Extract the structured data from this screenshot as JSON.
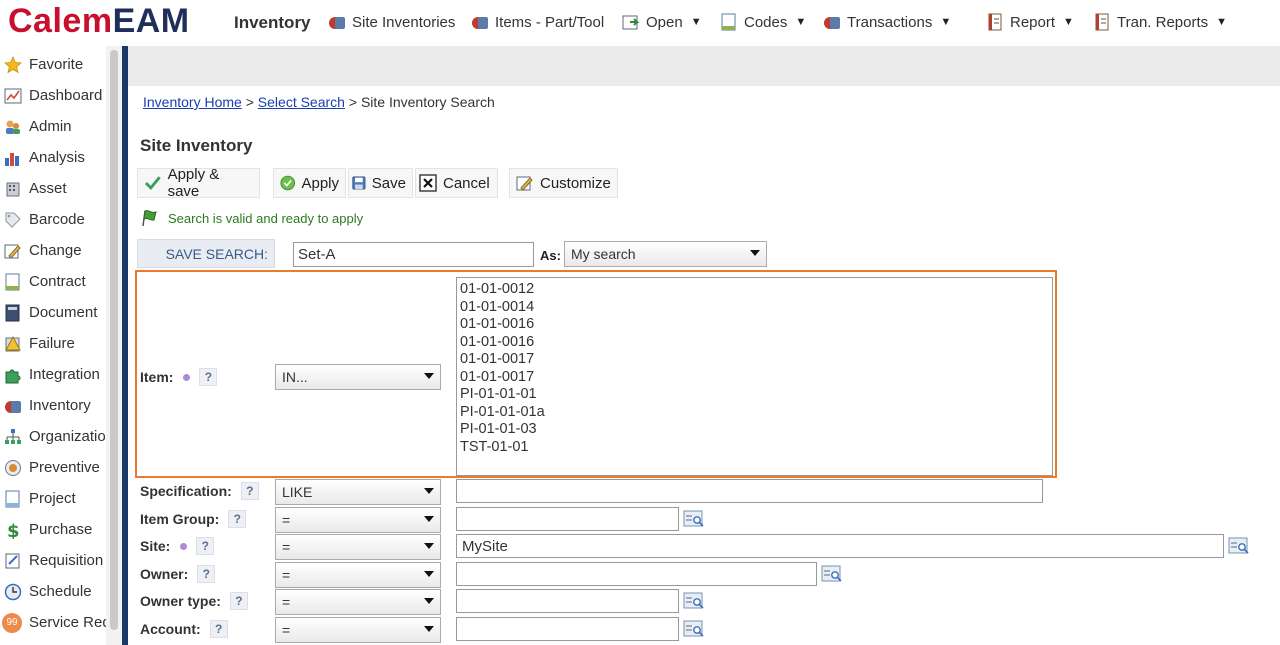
{
  "header": {
    "logo_part1": "Calem",
    "logo_part2": "EAM",
    "module": "Inventory",
    "menus": [
      {
        "label": "Site Inventories",
        "icon": "inventory-icon",
        "caret": false
      },
      {
        "label": "Items - Part/Tool",
        "icon": "inventory-icon",
        "caret": false
      },
      {
        "label": "Open",
        "icon": "open-icon",
        "caret": true
      },
      {
        "label": "Codes",
        "icon": "document-icon",
        "caret": true
      },
      {
        "label": "Transactions",
        "icon": "inventory-icon",
        "caret": true
      },
      {
        "label": "Report",
        "icon": "report-icon",
        "caret": true
      },
      {
        "label": "Tran. Reports",
        "icon": "report-icon",
        "caret": true
      }
    ]
  },
  "sidebar": {
    "items": [
      {
        "label": "Favorite",
        "icon": "star-icon"
      },
      {
        "label": "Dashboard",
        "icon": "dashboard-icon"
      },
      {
        "label": "Admin",
        "icon": "admin-icon"
      },
      {
        "label": "Analysis",
        "icon": "analysis-icon"
      },
      {
        "label": "Asset",
        "icon": "asset-icon"
      },
      {
        "label": "Barcode",
        "icon": "barcode-icon"
      },
      {
        "label": "Change",
        "icon": "change-icon"
      },
      {
        "label": "Contract",
        "icon": "contract-icon"
      },
      {
        "label": "Document",
        "icon": "document-icon"
      },
      {
        "label": "Failure",
        "icon": "failure-icon"
      },
      {
        "label": "Integration",
        "icon": "puzzle-icon"
      },
      {
        "label": "Inventory",
        "icon": "inventory-icon"
      },
      {
        "label": "Organization",
        "icon": "organization-icon"
      },
      {
        "label": "Preventive",
        "icon": "preventive-icon"
      },
      {
        "label": "Project",
        "icon": "project-icon"
      },
      {
        "label": "Purchase",
        "icon": "dollar-icon"
      },
      {
        "label": "Requisition",
        "icon": "requisition-icon"
      },
      {
        "label": "Schedule",
        "icon": "schedule-icon"
      },
      {
        "label": "Service Request",
        "icon": "service-request-icon",
        "badge": "99"
      }
    ]
  },
  "breadcrumb": {
    "link1": "Inventory Home",
    "sep1": " > ",
    "link2": "Select Search",
    "sep2": " > ",
    "current": "Site Inventory Search"
  },
  "page": {
    "title": "Site Inventory"
  },
  "toolbar": {
    "apply_save": "Apply & save",
    "apply": "Apply",
    "save": "Save",
    "cancel": "Cancel",
    "customize": "Customize"
  },
  "status": {
    "message": "Search is valid and ready to apply"
  },
  "save_search": {
    "label": "SAVE SEARCH:",
    "value": "Set-A",
    "as_label": "As:",
    "as_value": "My search"
  },
  "fields": {
    "item": {
      "label": "Item:",
      "operator": "IN...",
      "values": [
        "01-01-0012",
        "01-01-0014",
        "01-01-0016",
        "01-01-0016",
        "01-01-0017",
        "01-01-0017",
        "PI-01-01-01",
        "PI-01-01-01a",
        "PI-01-01-03",
        "TST-01-01"
      ]
    },
    "specification": {
      "label": "Specification:",
      "operator": "LIKE",
      "value": ""
    },
    "item_group": {
      "label": "Item Group:",
      "operator": "=",
      "value": ""
    },
    "site": {
      "label": "Site:",
      "operator": "=",
      "value": "MySite"
    },
    "owner": {
      "label": "Owner:",
      "operator": "=",
      "value": ""
    },
    "owner_type": {
      "label": "Owner type:",
      "operator": "=",
      "value": ""
    },
    "account": {
      "label": "Account:",
      "operator": "=",
      "value": ""
    }
  },
  "help_glyph": "?",
  "colors": {
    "brand_red": "#c8102e",
    "brand_navy": "#1f2f5c",
    "highlight_border": "#ec7a2c",
    "link": "#1a3fb0",
    "status_green": "#2c7a1f",
    "required_dot": "#a98bd6"
  }
}
